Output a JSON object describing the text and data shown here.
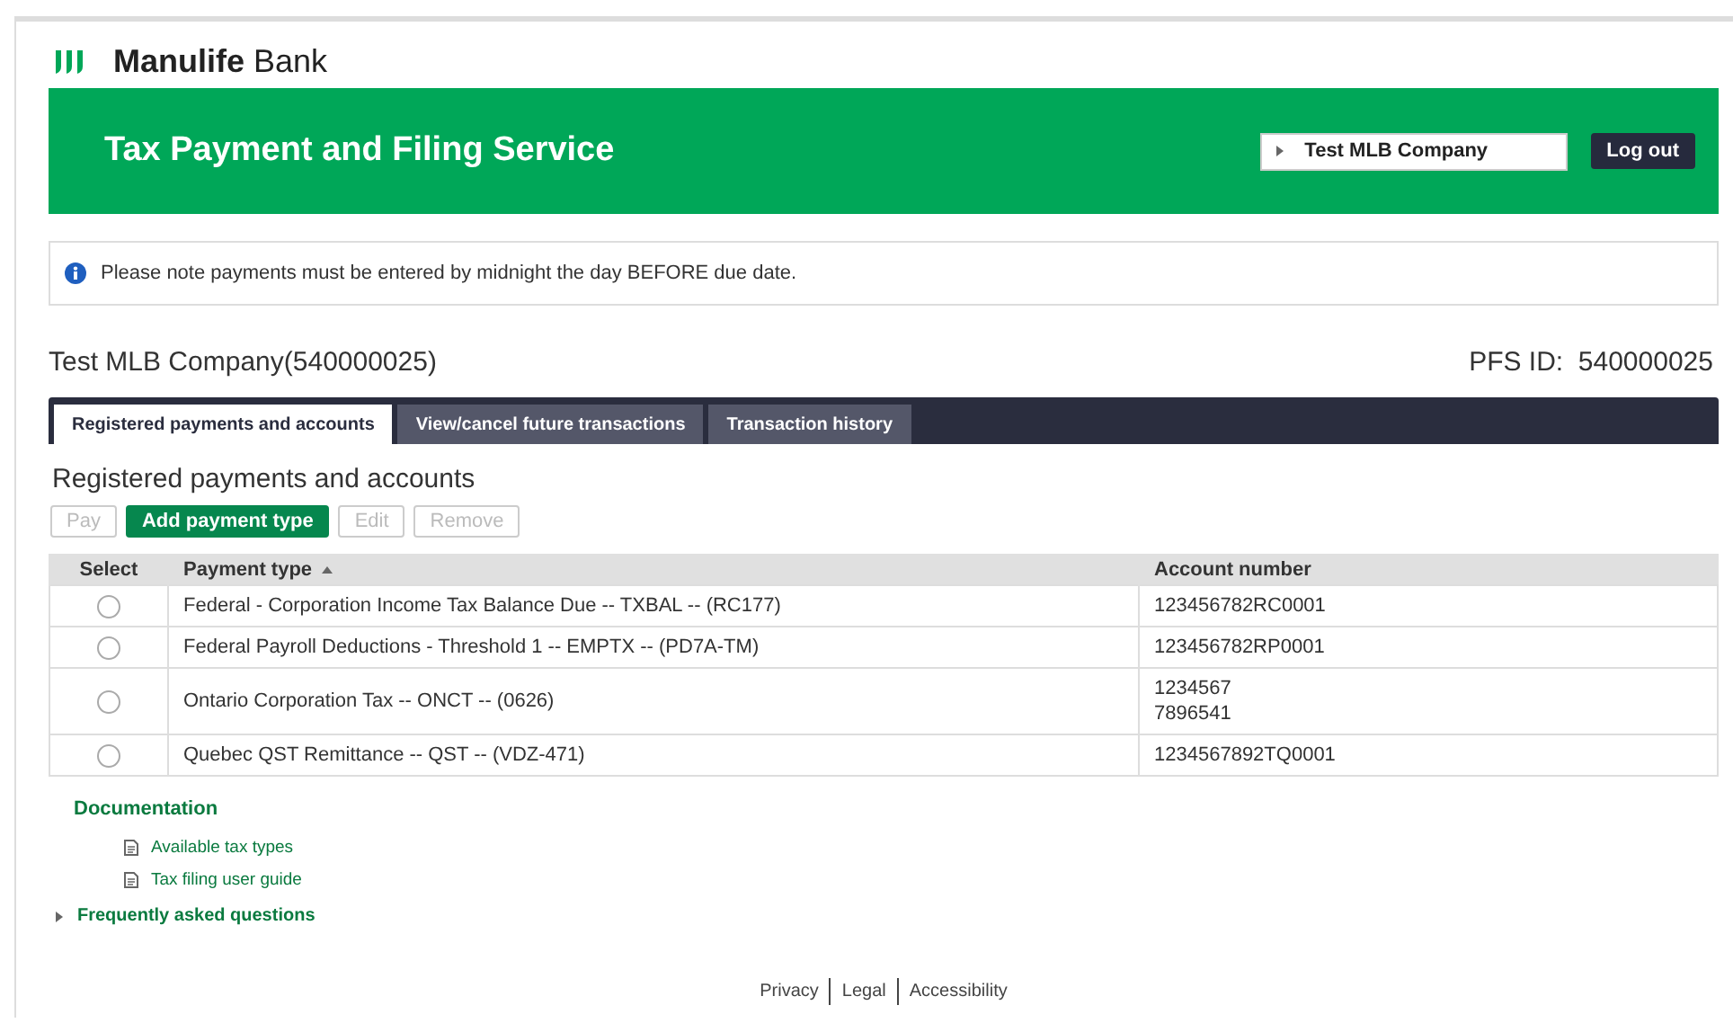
{
  "logo": {
    "brand": "Manulife",
    "suffix": "Bank"
  },
  "banner": {
    "title": "Tax Payment and Filing Service",
    "company_selector": "Test MLB Company",
    "logout": "Log out"
  },
  "notice": "Please note payments must be entered by midnight the day BEFORE due date.",
  "company": {
    "name": "Test MLB Company(540000025)",
    "pfs_label": "PFS ID:",
    "pfs_id": "540000025"
  },
  "tabs": [
    {
      "label": "Registered payments and accounts",
      "selected": true
    },
    {
      "label": "View/cancel future transactions",
      "selected": false
    },
    {
      "label": "Transaction history",
      "selected": false
    }
  ],
  "section_title": "Registered payments and accounts",
  "actions": [
    {
      "label": "Pay",
      "disabled": true
    },
    {
      "label": "Add payment type",
      "disabled": false
    },
    {
      "label": "Edit",
      "disabled": true
    },
    {
      "label": "Remove",
      "disabled": true
    }
  ],
  "table": {
    "columns": [
      {
        "label": "Select",
        "sorted": false
      },
      {
        "label": "Payment type",
        "sorted": true
      },
      {
        "label": "Account number",
        "sorted": false
      }
    ],
    "rows": [
      {
        "selected": false,
        "payment_type": "Federal - Corporation Income Tax Balance Due -- TXBAL -- (RC177)",
        "account_numbers": [
          "123456782RC0001"
        ]
      },
      {
        "selected": false,
        "payment_type": "Federal Payroll Deductions - Threshold 1 -- EMPTX -- (PD7A-TM)",
        "account_numbers": [
          "123456782RP0001"
        ]
      },
      {
        "selected": false,
        "payment_type": "Ontario Corporation Tax -- ONCT -- (0626)",
        "account_numbers": [
          "1234567",
          "7896541"
        ]
      },
      {
        "selected": false,
        "payment_type": "Quebec QST Remittance -- QST -- (VDZ-471)",
        "account_numbers": [
          "1234567892TQ0001"
        ]
      }
    ]
  },
  "documentation": {
    "title": "Documentation",
    "links": [
      "Available tax types",
      "Tax filing user guide"
    ]
  },
  "faq": {
    "label": "Frequently asked questions",
    "expanded": false
  },
  "footer_links": [
    "Privacy",
    "Legal",
    "Accessibility"
  ]
}
